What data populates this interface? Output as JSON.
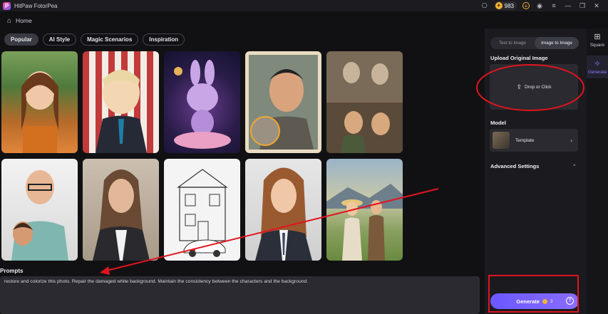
{
  "app": {
    "title": "HitPaw FotorPea",
    "coins": "983"
  },
  "nav": {
    "home_label": "Home"
  },
  "tabs": [
    {
      "label": "Popular",
      "active": true
    },
    {
      "label": "AI Style",
      "active": false
    },
    {
      "label": "Magic Scenarios",
      "active": false
    },
    {
      "label": "Inspiration",
      "active": false
    }
  ],
  "prompts": {
    "title": "Prompts",
    "text": "restore and colorize this photo. Repair the damaged white background. Maintain the consistency between the characters and the background."
  },
  "panel": {
    "mode_tabs": [
      {
        "label": "Text to Image",
        "active": false
      },
      {
        "label": "Image to Image",
        "active": true
      }
    ],
    "upload_title": "Upload Original Image",
    "upload_label": "Drop or Click",
    "model_title": "Model",
    "model_label": "Template",
    "advanced_title": "Advanced Settings",
    "generate_label": "Generate",
    "generate_cost": "2"
  },
  "rail": {
    "items": [
      {
        "label": "Square",
        "icon": "grid-icon",
        "active": false
      },
      {
        "label": "Generate",
        "icon": "sparkle-icon",
        "active": true
      }
    ]
  },
  "colors": {
    "accent": "#7a63ff",
    "annotation": "#e0141e",
    "coin": "#f2b233"
  }
}
